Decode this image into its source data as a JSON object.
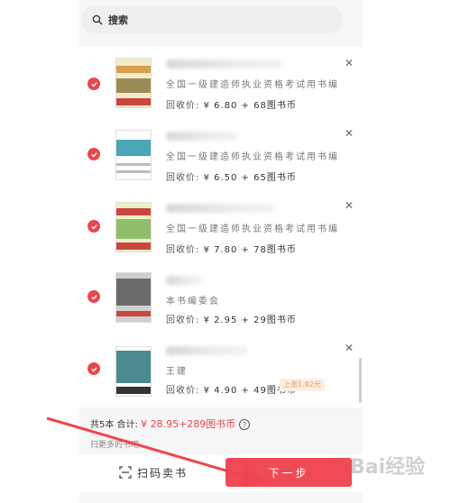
{
  "search": {
    "placeholder": "搜索"
  },
  "items": [
    {
      "desc": "全国一级建造师执业资格考试用书编写",
      "price_label": "回收价: ",
      "price": "¥ 6.80 + 68图书币"
    },
    {
      "desc": "全国一级建造师执业资格考试用书编写 ···",
      "price_label": "回收价: ",
      "price": "¥ 6.50 + 65图书币"
    },
    {
      "desc": "全国一级建造师执业资格考试用书编写 ···",
      "price_label": "回收价: ",
      "price": "¥ 7.80 + 78图书币"
    },
    {
      "desc": "本书编委会",
      "price_label": "回收价: ",
      "price": "¥ 2.95 + 29图书币"
    },
    {
      "desc": "王建",
      "price_label": "回收价: ",
      "price": "¥ 4.90 + 49图书币",
      "badge": "上涨1.92元"
    }
  ],
  "summary": {
    "count_label": "共5本  合计: ",
    "total": "¥ 28.95+289图书币",
    "hint": "扫更多的书吧"
  },
  "bottom": {
    "scan_label": "扫码卖书",
    "next_label": "下一步"
  },
  "watermark": "Bai经验",
  "colors": {
    "accent": "#ef4a55",
    "check": "#e9474f",
    "badge_bg": "#fdeee3",
    "badge_fg": "#e8955b"
  }
}
